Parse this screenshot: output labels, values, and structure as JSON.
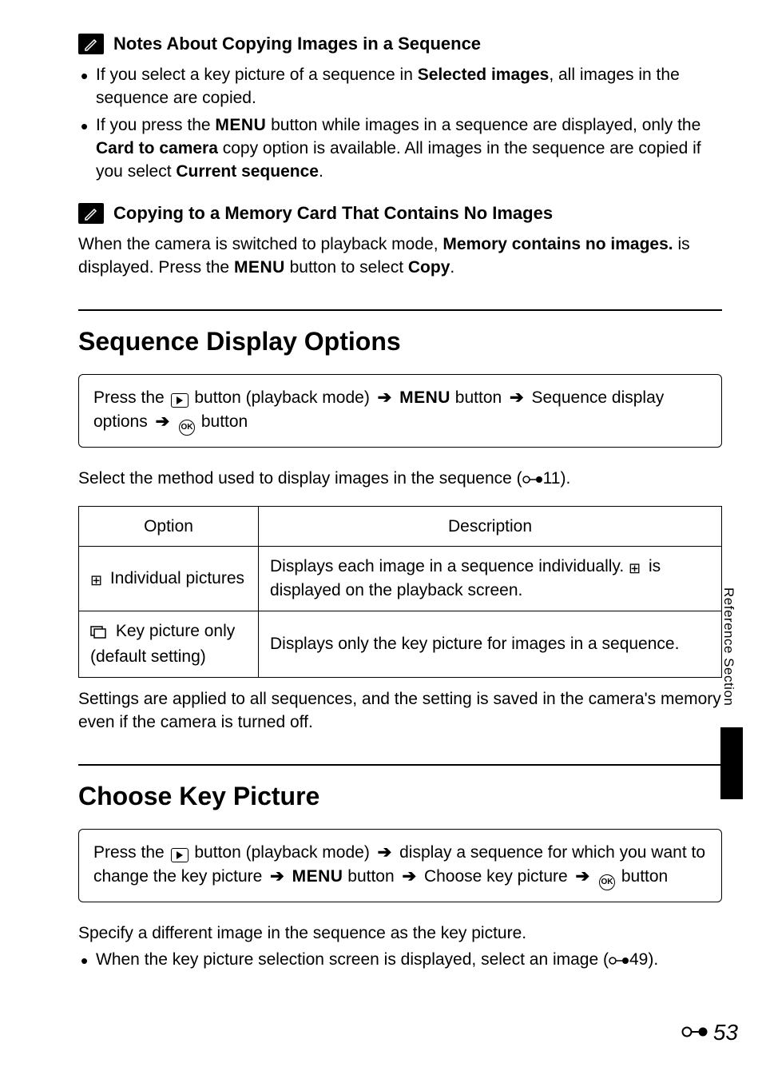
{
  "notes1": {
    "heading": "Notes About Copying Images in a Sequence",
    "bullet1_a": "If you select a key picture of a sequence in ",
    "bullet1_bold": "Selected images",
    "bullet1_b": ", all images in the sequence are copied.",
    "bullet2_a": "If you press the ",
    "bullet2_menu": "MENU",
    "bullet2_b": " button while images in a sequence are displayed, only the ",
    "bullet2_bold": "Card to camera",
    "bullet2_c": " copy option is available. All images in the sequence are copied if you select ",
    "bullet2_bold2": "Current sequence",
    "bullet2_d": "."
  },
  "notes2": {
    "heading": "Copying to a Memory Card That Contains No Images",
    "text_a": "When the camera is switched to playback mode, ",
    "text_bold": "Memory contains no images.",
    "text_b": " is displayed. Press the ",
    "text_menu": "MENU",
    "text_c": " button to select ",
    "text_bold2": "Copy",
    "text_d": "."
  },
  "seq": {
    "heading": "Sequence Display Options",
    "nav_a": "Press the ",
    "nav_b": " button (playback mode) ",
    "nav_menu": "MENU",
    "nav_c": " button ",
    "nav_d": " Sequence display options ",
    "nav_e": " button",
    "intro_a": "Select the method used to display images in the sequence (",
    "intro_ref": "11).",
    "table": {
      "h1": "Option",
      "h2": "Description",
      "r1c1": " Individual pictures",
      "r1c2": "Displays each image in a sequence individually. ",
      "r1c2b": " is displayed on the playback screen.",
      "r2c1a": " Key picture only",
      "r2c1b": "(default setting)",
      "r2c2": "Displays only the key picture for images in a sequence."
    },
    "after": "Settings are applied to all sequences, and the setting is saved in the camera's memory even if the camera is turned off."
  },
  "key": {
    "heading": "Choose Key Picture",
    "nav_a": "Press the ",
    "nav_b": " button (playback mode) ",
    "nav_c": " display a sequence for which you want to change the key picture ",
    "nav_menu": "MENU",
    "nav_d": " button ",
    "nav_e": " Choose key picture ",
    "nav_f": " button",
    "body1": "Specify a different image in the sequence as the key picture.",
    "bullet_a": "When the key picture selection screen is displayed, select an image (",
    "bullet_ref": "49)."
  },
  "side_tab": "Reference Section",
  "page_num": "53"
}
